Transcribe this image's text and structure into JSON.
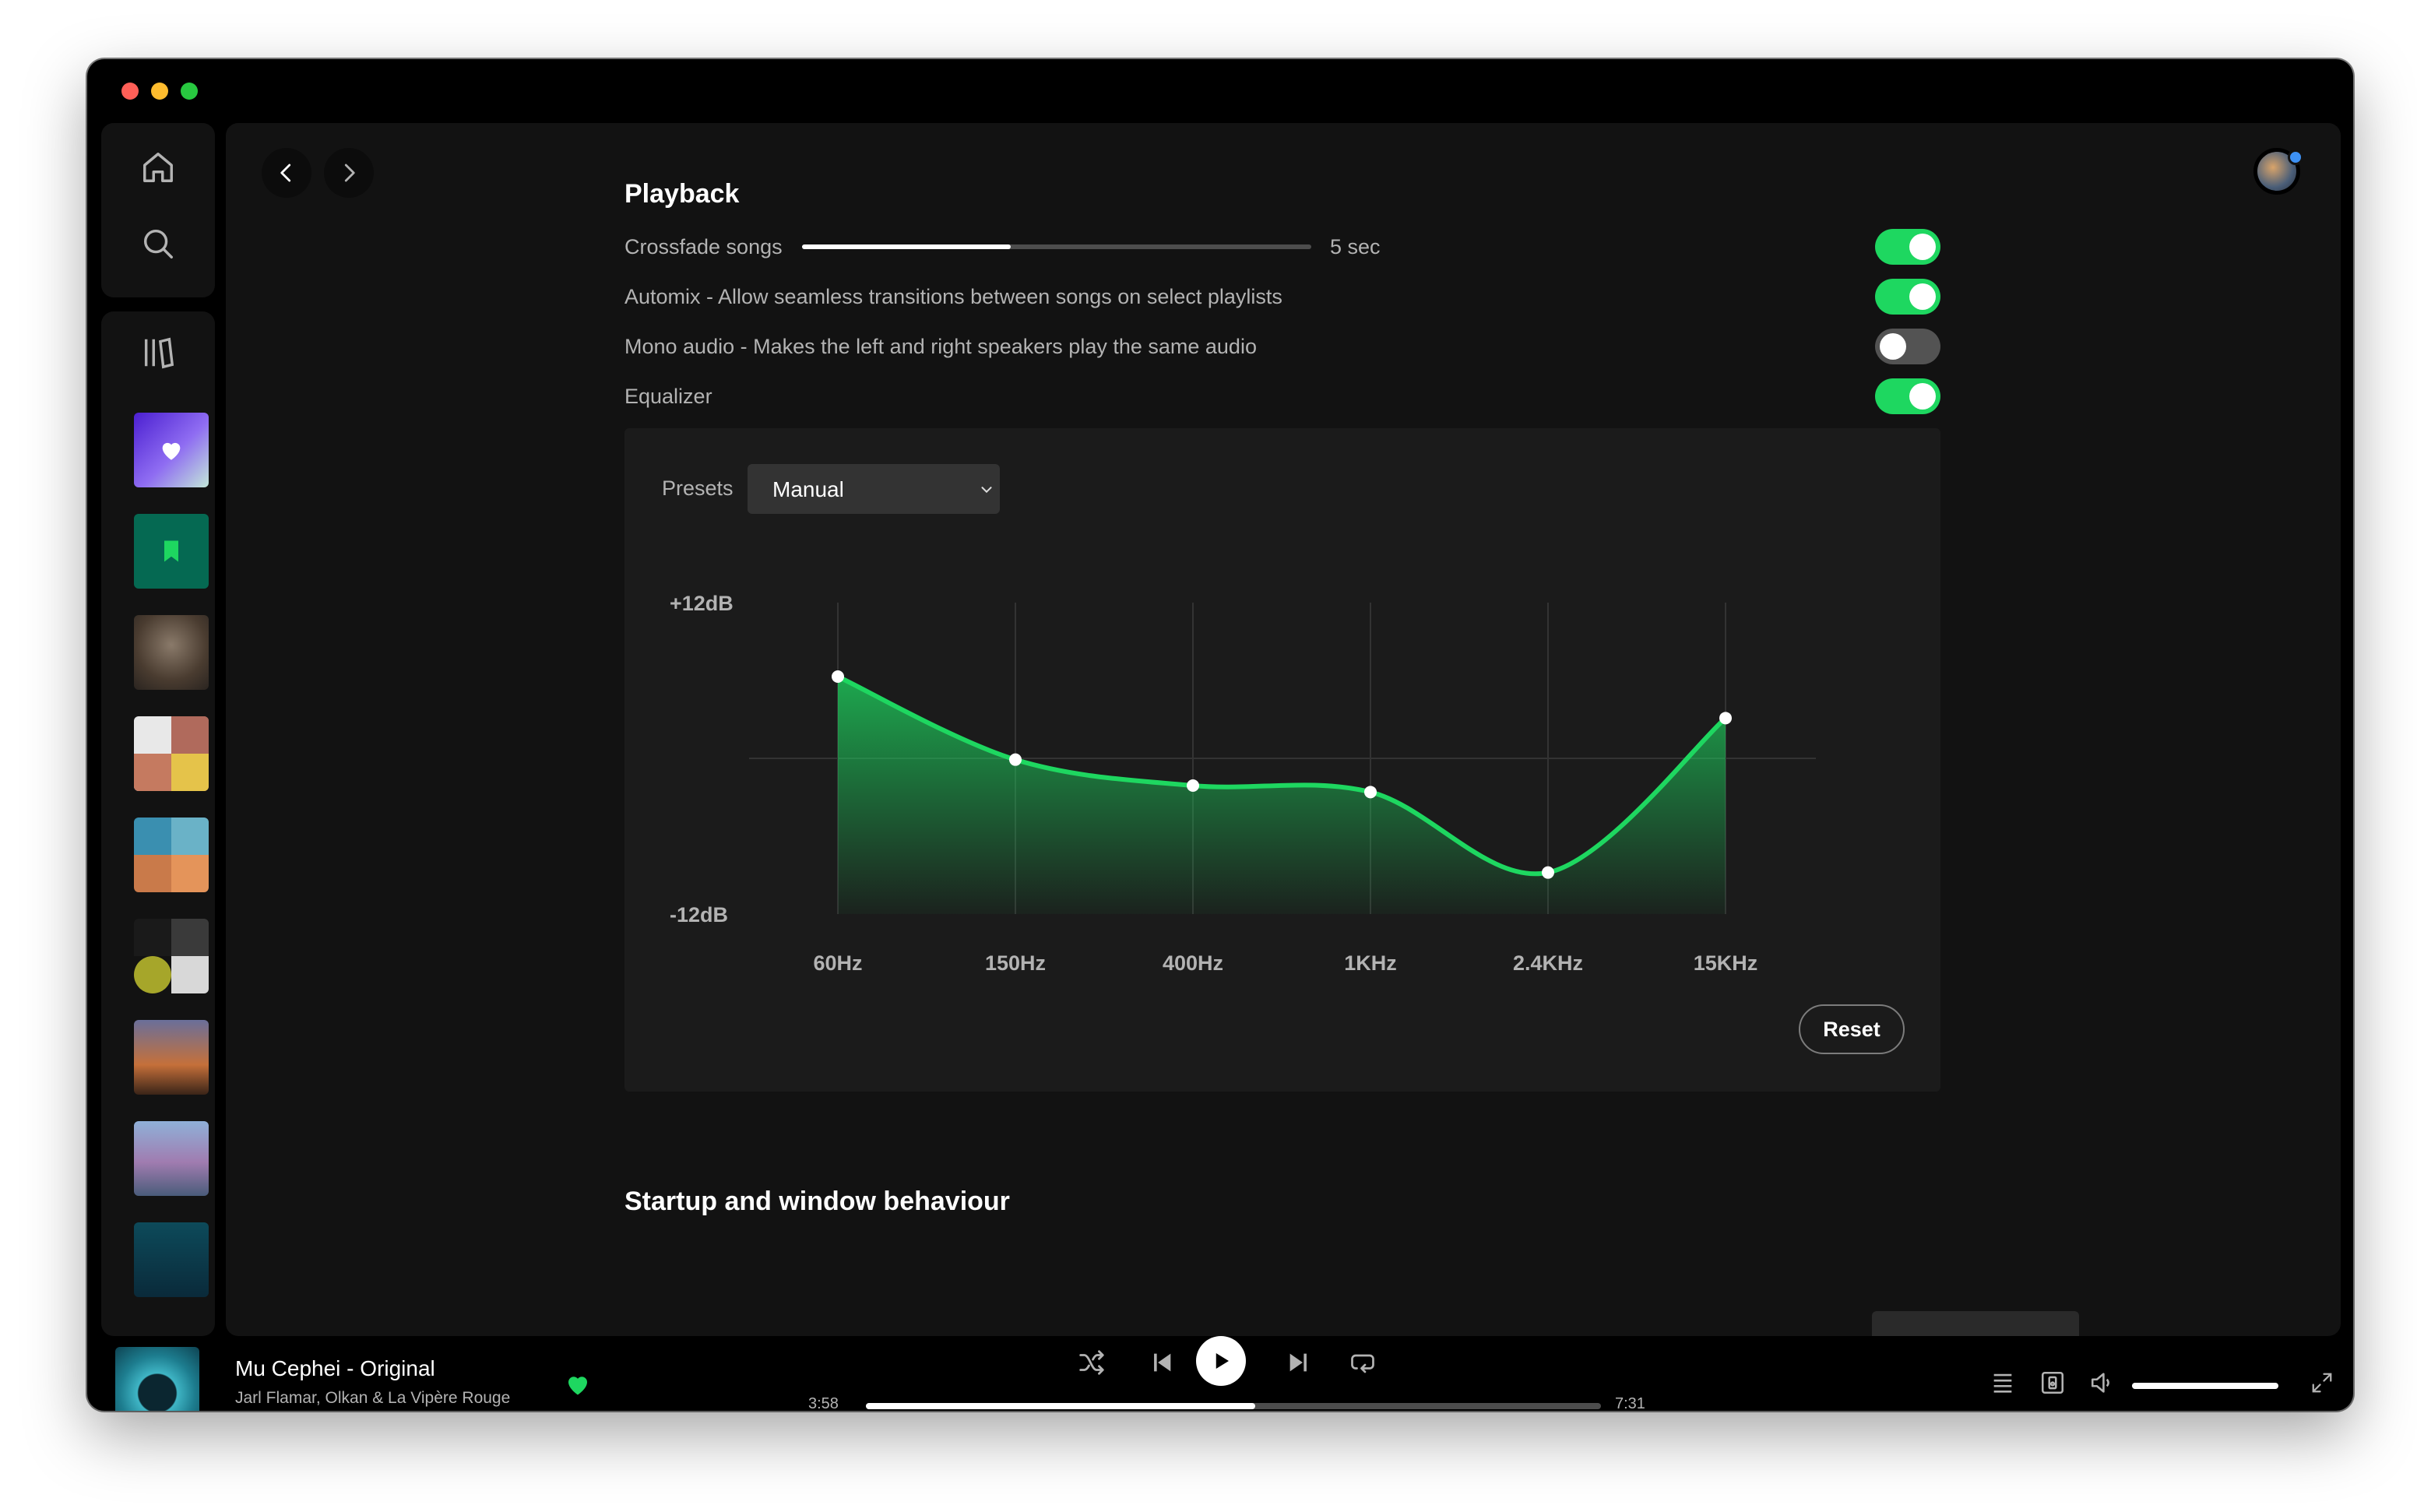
{
  "playback": {
    "title": "Playback",
    "crossfade": {
      "label": "Crossfade songs",
      "value": "5 sec",
      "fraction": 0.41,
      "enabled": true
    },
    "automix": {
      "label": "Automix - Allow seamless transitions between songs on select playlists",
      "enabled": true
    },
    "mono_audio": {
      "label": "Mono audio - Makes the left and right speakers play the same audio",
      "enabled": false
    },
    "equalizer": {
      "label": "Equalizer",
      "enabled": true
    }
  },
  "equalizer_panel": {
    "presets_label": "Presets",
    "preset_value": "Manual",
    "reset_label": "Reset",
    "chart_data": {
      "type": "area",
      "ylabel_top": "+12dB",
      "ylabel_bottom": "-12dB",
      "ylim": [
        -12,
        12
      ],
      "x": [
        "60Hz",
        "150Hz",
        "400Hz",
        "1KHz",
        "2.4KHz",
        "15KHz"
      ],
      "values": [
        6.3,
        -0.1,
        -2.1,
        -2.6,
        -8.8,
        3.1
      ],
      "color": "#1ed760"
    }
  },
  "startup": {
    "title": "Startup and window behaviour"
  },
  "now_playing": {
    "title": "Mu Cephei - Original",
    "artist": "Jarl Flamar, Olkan & La Vipère Rouge",
    "liked": true,
    "elapsed": "3:58",
    "duration": "7:31",
    "progress": 0.53,
    "volume": 1.0
  },
  "colors": {
    "accent": "#1ed760",
    "background": "#121212",
    "panel": "#1b1b1b"
  }
}
